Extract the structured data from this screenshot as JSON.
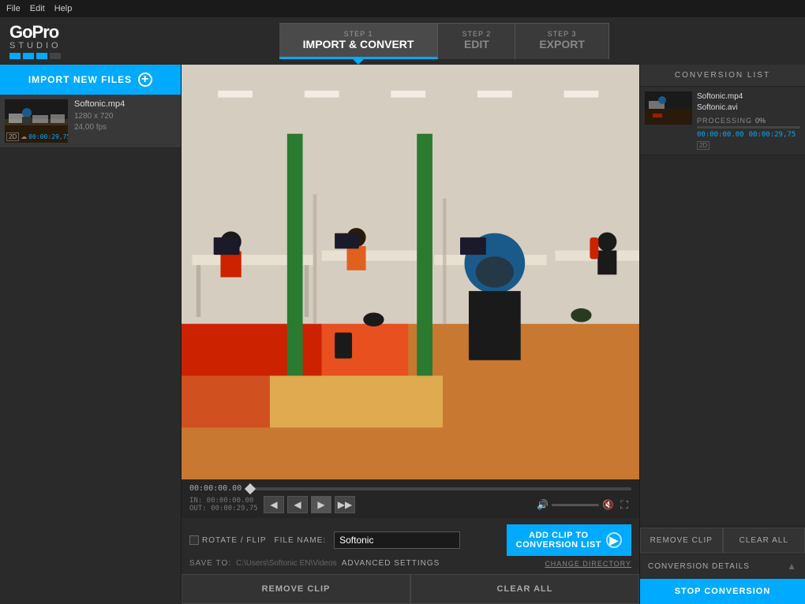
{
  "titlebar": {
    "menu_items": [
      "File",
      "Edit",
      "Help"
    ]
  },
  "logo": {
    "brand": "GoPro",
    "product": "STUDIO",
    "squares": [
      "#00aaff",
      "#00aaff",
      "#00aaff",
      "#444"
    ]
  },
  "steps": [
    {
      "id": "step1",
      "num": "STEP 1",
      "label": "IMPORT & CONVERT",
      "active": true
    },
    {
      "id": "step2",
      "num": "STEP 2",
      "label": "EDIT",
      "active": false
    },
    {
      "id": "step3",
      "num": "STEP 3",
      "label": "EXPORT",
      "active": false
    }
  ],
  "import_button": {
    "label": "IMPORT NEW FILES"
  },
  "clip": {
    "name": "Softonic.mp4",
    "resolution": "1280 x 720",
    "fps": "24,00 fps",
    "duration": "00:00:29,75",
    "badge_2d": "2D",
    "badge_icon": "☁"
  },
  "timeline": {
    "current_time": "00:00:00.00",
    "in_point": "IN: 00:00:00.00",
    "out_point": "OUT: 00:00:29,75"
  },
  "file_controls": {
    "rotate_flip_label": "ROTATE / FLIP",
    "file_name_label": "FILE NAME:",
    "file_name_value": "Softonic",
    "save_to_label": "SAVE TO:",
    "save_path": "C:\\Users\\Softonic EN\\Videos",
    "change_dir_label": "CHANGE DIRECTORY",
    "advanced_settings_label": "ADVANCED SETTINGS"
  },
  "add_clip_btn": {
    "line1": "ADD CLIP TO",
    "line2": "CONVERSION LIST"
  },
  "footer": {
    "remove_clip_label": "REMOVE CLIP",
    "clear_all_label": "CLEAR ALL"
  },
  "conversion_list": {
    "header": "CONVERSION LIST",
    "item": {
      "filename1": "Softonic.mp4",
      "filename2": "Softonic.avi",
      "status_label": "PROCESSING",
      "progress": "0%",
      "time1": "00:00:00.00",
      "time2": "00:00:29,75",
      "badge_2d": "2D"
    }
  },
  "conversion_actions": {
    "remove_clip": "REMOVE CLIP",
    "clear_all": "CLEAR ALL"
  },
  "conversion_details": {
    "header": "CONVERSION DETAILS",
    "stop_btn": "STOP CONVERSION"
  }
}
